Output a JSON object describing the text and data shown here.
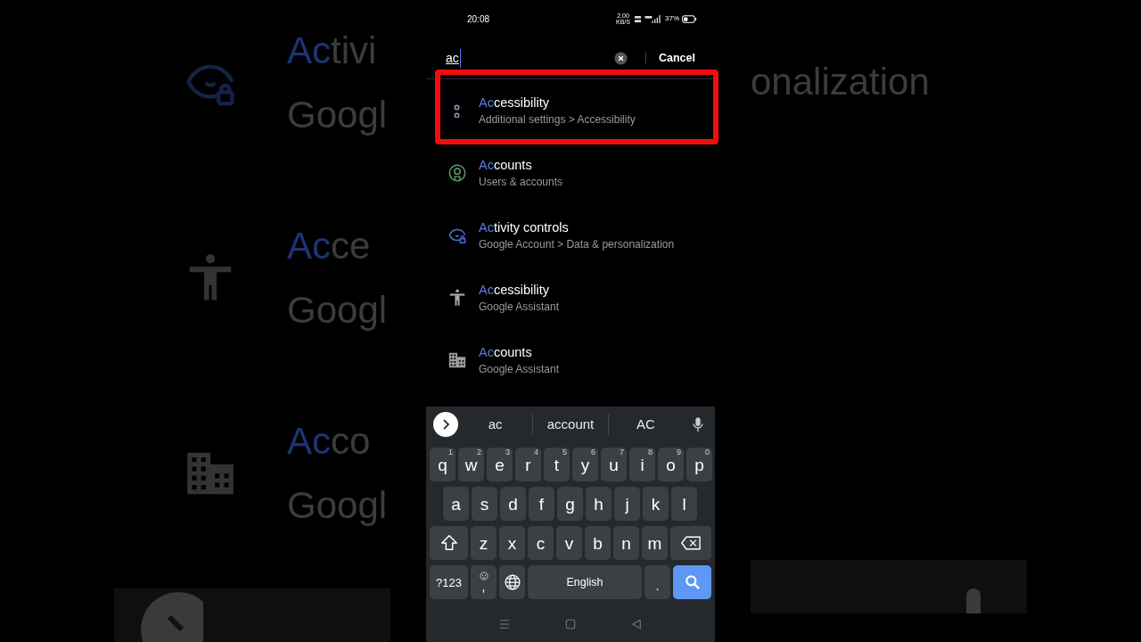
{
  "backdrop_left": {
    "rows": [
      {
        "kind": "eye-lock",
        "match": "Ac",
        "rest": "tivi",
        "subtitle": "Googl"
      },
      {
        "kind": "accessibility",
        "match": "Ac",
        "rest": "ce",
        "subtitle": "Googl"
      },
      {
        "kind": "building",
        "match": "Ac",
        "rest": "co",
        "subtitle": "Googl"
      }
    ]
  },
  "backdrop_right": {
    "text": "onalization"
  },
  "status_bar": {
    "time": "20:08",
    "speed": "2.00",
    "speed_unit": "KB/S",
    "battery_text": "37%"
  },
  "search": {
    "value": "ac",
    "cancel": "Cancel"
  },
  "results": [
    {
      "kind": "dots",
      "match": "Ac",
      "rest": "cessibility",
      "subtitle": "Additional settings > Accessibility",
      "highlighted": true
    },
    {
      "kind": "person-circle",
      "match": "Ac",
      "rest": "counts",
      "subtitle": "Users & accounts",
      "highlighted": false
    },
    {
      "kind": "eye-lock",
      "match": "Ac",
      "rest": "tivity controls",
      "subtitle": "Google Account > Data & personalization",
      "highlighted": false
    },
    {
      "kind": "accessibility",
      "match": "Ac",
      "rest": "cessibility",
      "subtitle": "Google Assistant",
      "highlighted": false
    },
    {
      "kind": "building",
      "match": "Ac",
      "rest": "counts",
      "subtitle": "Google Assistant",
      "highlighted": false
    }
  ],
  "keyboard": {
    "suggestions": [
      "ac",
      "account",
      "AC"
    ],
    "rows": [
      {
        "keys": [
          {
            "kind": "letter",
            "label": "q",
            "hint": "1"
          },
          {
            "kind": "letter",
            "label": "w",
            "hint": "2"
          },
          {
            "kind": "letter",
            "label": "e",
            "hint": "3"
          },
          {
            "kind": "letter",
            "label": "r",
            "hint": "4"
          },
          {
            "kind": "letter",
            "label": "t",
            "hint": "5"
          },
          {
            "kind": "letter",
            "label": "y",
            "hint": "6"
          },
          {
            "kind": "letter",
            "label": "u",
            "hint": "7"
          },
          {
            "kind": "letter",
            "label": "i",
            "hint": "8"
          },
          {
            "kind": "letter",
            "label": "o",
            "hint": "9"
          },
          {
            "kind": "letter",
            "label": "p",
            "hint": "0"
          }
        ]
      },
      {
        "keys": [
          {
            "kind": "letter",
            "label": "a"
          },
          {
            "kind": "letter",
            "label": "s"
          },
          {
            "kind": "letter",
            "label": "d"
          },
          {
            "kind": "letter",
            "label": "f"
          },
          {
            "kind": "letter",
            "label": "g"
          },
          {
            "kind": "letter",
            "label": "h"
          },
          {
            "kind": "letter",
            "label": "j"
          },
          {
            "kind": "letter",
            "label": "k"
          },
          {
            "kind": "letter",
            "label": "l"
          }
        ]
      },
      {
        "keys": [
          {
            "kind": "shift"
          },
          {
            "kind": "letter",
            "label": "z"
          },
          {
            "kind": "letter",
            "label": "x"
          },
          {
            "kind": "letter",
            "label": "c"
          },
          {
            "kind": "letter",
            "label": "v"
          },
          {
            "kind": "letter",
            "label": "b"
          },
          {
            "kind": "letter",
            "label": "n"
          },
          {
            "kind": "letter",
            "label": "m"
          },
          {
            "kind": "backspace"
          }
        ]
      },
      {
        "keys": [
          {
            "kind": "symbols",
            "label": "?123"
          },
          {
            "kind": "emoji-comma",
            "label": ","
          },
          {
            "kind": "globe"
          },
          {
            "kind": "space",
            "label": "English"
          },
          {
            "kind": "period",
            "label": "."
          },
          {
            "kind": "search"
          }
        ]
      }
    ]
  }
}
